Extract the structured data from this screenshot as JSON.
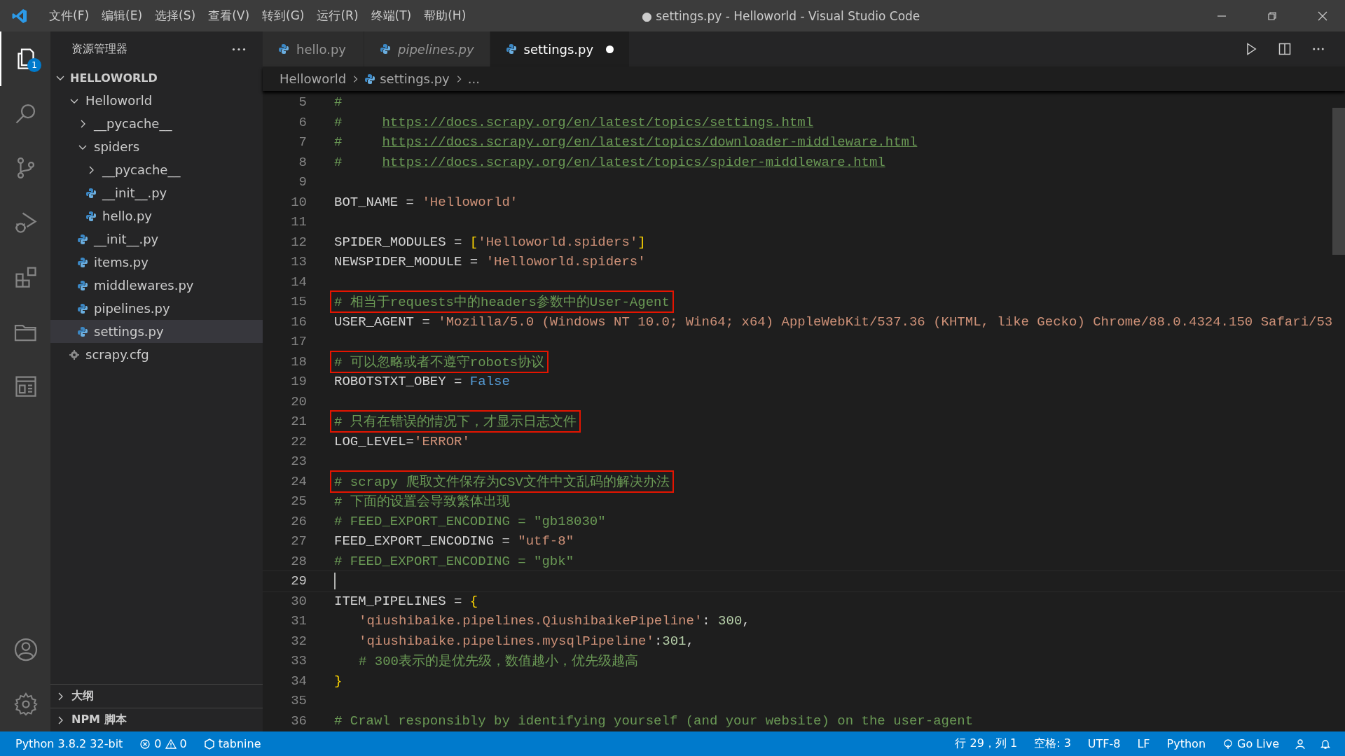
{
  "window": {
    "title": "● settings.py - Helloworld - Visual Studio Code"
  },
  "menu": [
    "文件(F)",
    "编辑(E)",
    "选择(S)",
    "查看(V)",
    "转到(G)",
    "运行(R)",
    "终端(T)",
    "帮助(H)"
  ],
  "activity_bar": {
    "items": [
      {
        "kind": "explorer",
        "selected": true,
        "badge": "1"
      },
      {
        "kind": "search",
        "selected": false
      },
      {
        "kind": "source-control",
        "selected": false
      },
      {
        "kind": "run",
        "selected": false
      },
      {
        "kind": "extensions",
        "selected": false
      },
      {
        "kind": "folder",
        "selected": false
      },
      {
        "kind": "panel",
        "selected": false
      }
    ],
    "bottom": [
      {
        "kind": "account"
      },
      {
        "kind": "settings"
      }
    ]
  },
  "explorer": {
    "title": "资源管理器",
    "workspace": {
      "label": "HELLOWORLD",
      "expanded": true
    },
    "tree": [
      {
        "label": "Helloworld",
        "kind": "folder",
        "expanded": true,
        "selected": false,
        "children": [
          {
            "label": "__pycache__",
            "kind": "folder",
            "expanded": false,
            "selected": false
          },
          {
            "label": "spiders",
            "kind": "folder",
            "expanded": true,
            "selected": false,
            "children": [
              {
                "label": "__pycache__",
                "kind": "folder",
                "expanded": false,
                "selected": false
              },
              {
                "label": "__init__.py",
                "kind": "python",
                "selected": false
              },
              {
                "label": "hello.py",
                "kind": "python",
                "selected": false
              }
            ]
          },
          {
            "label": "__init__.py",
            "kind": "python",
            "selected": false
          },
          {
            "label": "items.py",
            "kind": "python",
            "selected": false
          },
          {
            "label": "middlewares.py",
            "kind": "python",
            "selected": false
          },
          {
            "label": "pipelines.py",
            "kind": "python",
            "selected": false
          },
          {
            "label": "settings.py",
            "kind": "python",
            "selected": true
          }
        ]
      },
      {
        "label": "scrapy.cfg",
        "kind": "config",
        "selected": false
      }
    ],
    "sections": [
      {
        "label": "大纲",
        "expanded": false
      },
      {
        "label": "NPM 脚本",
        "expanded": false
      }
    ]
  },
  "tabs": [
    {
      "label": "hello.py",
      "selected": false,
      "preview": false,
      "modified": false
    },
    {
      "label": "pipelines.py",
      "selected": false,
      "preview": true,
      "modified": false
    },
    {
      "label": "settings.py",
      "selected": true,
      "preview": false,
      "modified": true
    }
  ],
  "breadcrumb": [
    "Helloworld",
    "settings.py",
    "..."
  ],
  "code": [
    {
      "no": "5",
      "tokens": [
        {
          "kind": "comment",
          "text": "#"
        }
      ]
    },
    {
      "no": "6",
      "tokens": [
        {
          "kind": "comment",
          "text": "#     "
        },
        {
          "kind": "link",
          "text": "https://docs.scrapy.org/en/latest/topics/settings.html"
        }
      ]
    },
    {
      "no": "7",
      "tokens": [
        {
          "kind": "comment",
          "text": "#     "
        },
        {
          "kind": "link",
          "text": "https://docs.scrapy.org/en/latest/topics/downloader-middleware.html"
        }
      ]
    },
    {
      "no": "8",
      "tokens": [
        {
          "kind": "comment",
          "text": "#     "
        },
        {
          "kind": "link",
          "text": "https://docs.scrapy.org/en/latest/topics/spider-middleware.html"
        }
      ]
    },
    {
      "no": "9"
    },
    {
      "no": "10",
      "tokens": [
        {
          "kind": "plain",
          "text": "BOT_NAME = "
        },
        {
          "kind": "string",
          "text": "'Helloworld'"
        }
      ]
    },
    {
      "no": "11"
    },
    {
      "no": "12",
      "tokens": [
        {
          "kind": "plain",
          "text": "SPIDER_MODULES = "
        },
        {
          "kind": "brace",
          "text": "["
        },
        {
          "kind": "string",
          "text": "'Helloworld.spiders'"
        },
        {
          "kind": "brace",
          "text": "]"
        }
      ]
    },
    {
      "no": "13",
      "tokens": [
        {
          "kind": "plain",
          "text": "NEWSPIDER_MODULE = "
        },
        {
          "kind": "string",
          "text": "'Helloworld.spiders'"
        }
      ]
    },
    {
      "no": "14"
    },
    {
      "no": "15",
      "boxed": true,
      "tokens": [
        {
          "kind": "comment",
          "text": "# 相当于requests中的headers参数中的User-Agent"
        }
      ]
    },
    {
      "no": "16",
      "tokens": [
        {
          "kind": "plain",
          "text": "USER_AGENT = "
        },
        {
          "kind": "string",
          "text": "'Mozilla/5.0 (Windows NT 10.0; Win64; x64) AppleWebKit/537.36 (KHTML, like Gecko) Chrome/88.0.4324.150 Safari/53"
        }
      ]
    },
    {
      "no": "17"
    },
    {
      "no": "18",
      "boxed": true,
      "tokens": [
        {
          "kind": "comment",
          "text": "# 可以忽略或者不遵守robots协议"
        }
      ]
    },
    {
      "no": "19",
      "tokens": [
        {
          "kind": "plain",
          "text": "ROBOTSTXT_OBEY = "
        },
        {
          "kind": "keyword",
          "text": "False"
        }
      ]
    },
    {
      "no": "20"
    },
    {
      "no": "21",
      "boxed": true,
      "tokens": [
        {
          "kind": "comment",
          "text": "# 只有在错误的情况下，才显示日志文件"
        }
      ]
    },
    {
      "no": "22",
      "tokens": [
        {
          "kind": "plain",
          "text": "LOG_LEVEL="
        },
        {
          "kind": "string",
          "text": "'ERROR'"
        }
      ]
    },
    {
      "no": "23"
    },
    {
      "no": "24",
      "boxed": true,
      "tokens": [
        {
          "kind": "comment",
          "text": "# scrapy 爬取文件保存为CSV文件中文乱码的解决办法"
        }
      ]
    },
    {
      "no": "25",
      "tokens": [
        {
          "kind": "comment",
          "text": "# 下面的设置会导致繁体出现"
        }
      ]
    },
    {
      "no": "26",
      "tokens": [
        {
          "kind": "comment",
          "text": "# FEED_EXPORT_ENCODING = \"gb18030\""
        }
      ]
    },
    {
      "no": "27",
      "tokens": [
        {
          "kind": "plain",
          "text": "FEED_EXPORT_ENCODING = "
        },
        {
          "kind": "string",
          "text": "\"utf-8\""
        }
      ]
    },
    {
      "no": "28",
      "tokens": [
        {
          "kind": "comment",
          "text": "# FEED_EXPORT_ENCODING = \"gbk\""
        }
      ]
    },
    {
      "no": "29",
      "current": true
    },
    {
      "no": "30",
      "tokens": [
        {
          "kind": "plain",
          "text": "ITEM_PIPELINES = "
        },
        {
          "kind": "brace",
          "text": "{"
        }
      ]
    },
    {
      "no": "31",
      "indented": true,
      "tokens": [
        {
          "kind": "string",
          "text": "'qiushibaike.pipelines.QiushibaikePipeline'"
        },
        {
          "kind": "plain",
          "text": ": "
        },
        {
          "kind": "number",
          "text": "300"
        },
        {
          "kind": "plain",
          "text": ","
        }
      ]
    },
    {
      "no": "32",
      "indented": true,
      "tokens": [
        {
          "kind": "string",
          "text": "'qiushibaike.pipelines.mysqlPipeline'"
        },
        {
          "kind": "plain",
          "text": ":"
        },
        {
          "kind": "number",
          "text": "301"
        },
        {
          "kind": "plain",
          "text": ","
        }
      ]
    },
    {
      "no": "33",
      "indented": true,
      "tokens": [
        {
          "kind": "comment",
          "text": "# 300表示的是优先级，数值越小，优先级越高"
        }
      ]
    },
    {
      "no": "34",
      "tokens": [
        {
          "kind": "brace",
          "text": "}"
        }
      ]
    },
    {
      "no": "35"
    },
    {
      "no": "36",
      "tokens": [
        {
          "kind": "comment",
          "text": "# Crawl responsibly by identifying yourself (and your website) on the user-agent"
        }
      ]
    }
  ],
  "status_bar": {
    "interpreter": "Python 3.8.2 32-bit",
    "errors": "0",
    "warnings": "0",
    "extension": "tabnine",
    "position": "行 29，列 1",
    "indent": "空格: 3",
    "encoding": "UTF-8",
    "eol": "LF",
    "language": "Python",
    "live": "Go Live"
  }
}
